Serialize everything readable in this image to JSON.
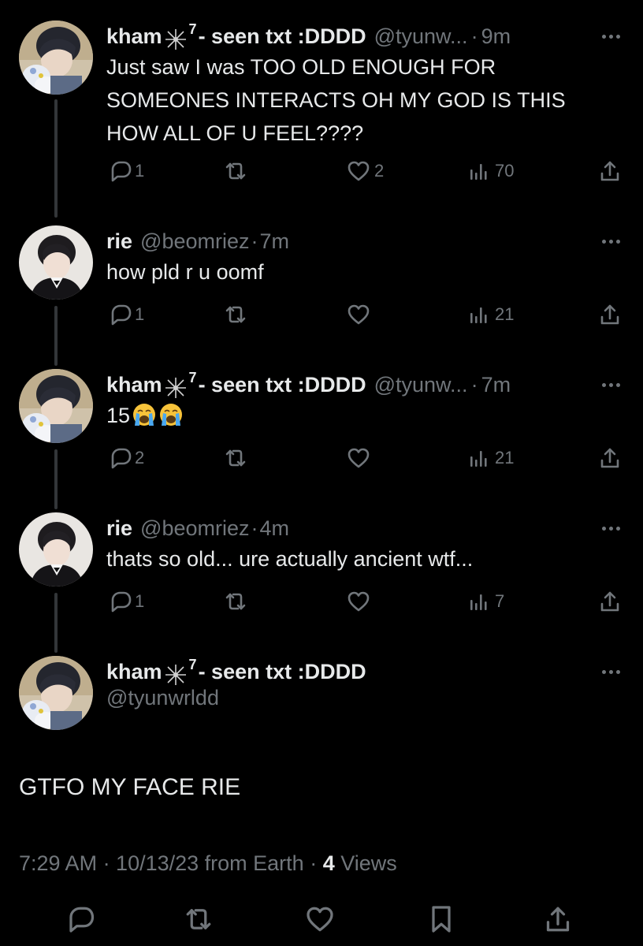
{
  "replies": [
    {
      "name": "kham",
      "name_suffix": "- seen txt :DDDD",
      "sup": "7",
      "handle": "@tyunw...",
      "time": "9m",
      "text": "Just saw I was TOO OLD ENOUGH FOR\nSOMEONES INTERACTS OH MY GOD IS THIS\nHOW ALL OF U FEEL????",
      "counts": {
        "reply": "1",
        "retweet": "",
        "like": "2",
        "views": "70"
      }
    },
    {
      "name": "rie",
      "handle": "@beomriez",
      "time": "7m",
      "text": "how pld r u oomf",
      "counts": {
        "reply": "1",
        "retweet": "",
        "like": "",
        "views": "21"
      }
    },
    {
      "name": "kham",
      "name_suffix": "- seen txt :DDDD",
      "sup": "7",
      "handle": "@tyunw...",
      "time": "7m",
      "text": "15",
      "emoji": [
        "loudly-crying-face-emoji",
        "loudly-crying-face-emoji"
      ],
      "counts": {
        "reply": "2",
        "retweet": "",
        "like": "",
        "views": "21"
      }
    },
    {
      "name": "rie",
      "handle": "@beomriez",
      "time": "4m",
      "text": "thats so old... ure actually ancient wtf...",
      "counts": {
        "reply": "1",
        "retweet": "",
        "like": "",
        "views": "7"
      }
    }
  ],
  "main_tweet": {
    "name": "kham",
    "name_suffix": "- seen txt :DDDD",
    "sup": "7",
    "handle": "@tyunwrldd",
    "text": "GTFO MY FACE RIE",
    "meta_prefix": "7:29 AM · 10/13/23 from Earth · ",
    "views_count": "4",
    "views_label": " Views"
  },
  "separator": "·",
  "colors": {
    "background": "#000000",
    "text": "#e7e9ea",
    "muted": "#71767b",
    "thread_line": "#333639"
  },
  "bottom_actions": [
    "reply-icon",
    "retweet-icon",
    "like-icon",
    "bookmark-icon",
    "share-icon"
  ]
}
